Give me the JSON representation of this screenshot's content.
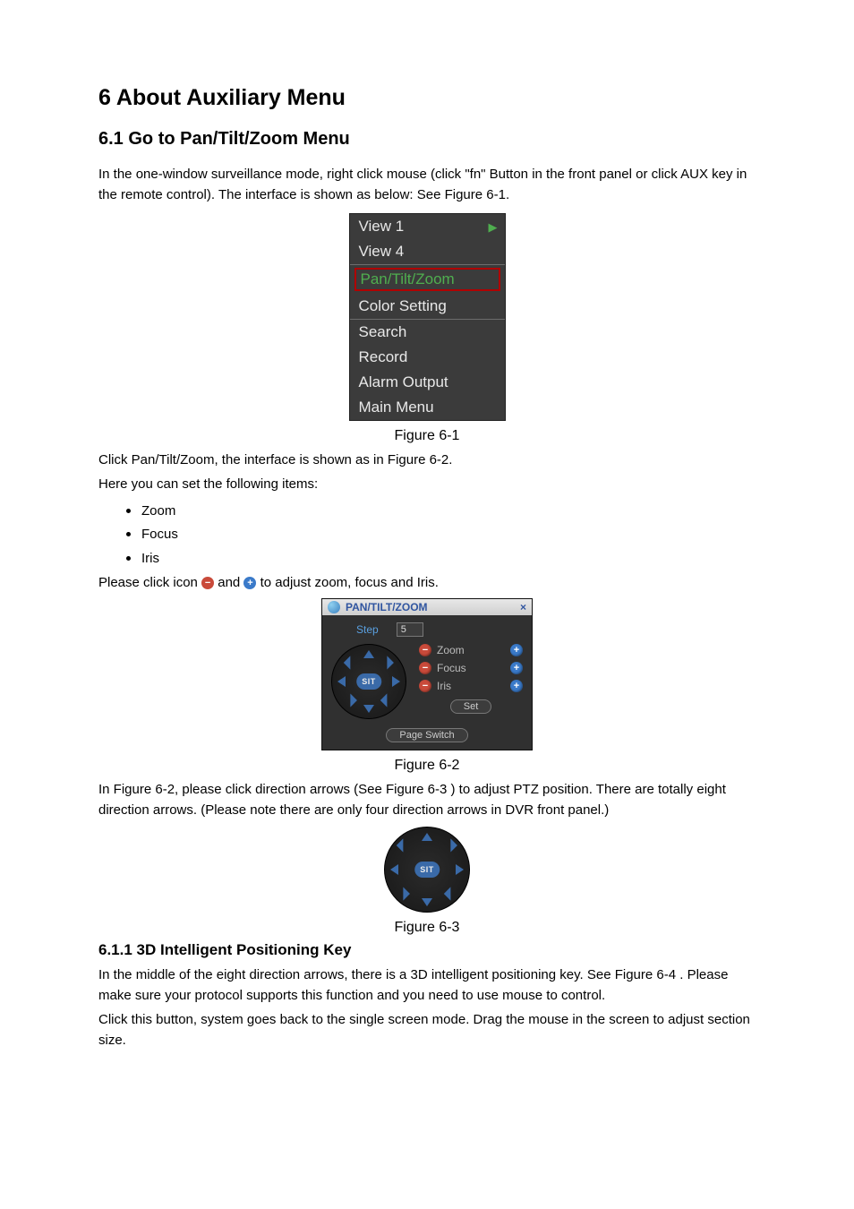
{
  "titles": {
    "h1": "6  About Auxiliary Menu",
    "h2": "6.1    Go to Pan/Tilt/Zoom Menu",
    "h3": "6.1.1  3D Intelligent Positioning Key"
  },
  "paras": {
    "p1": "In the one-window surveillance mode, right click mouse (click \"fn\" Button in the front panel or click AUX key in the remote control). The interface is shown as below: See Figure 6-1.",
    "p2": "Click Pan/Tilt/Zoom, the interface is shown as in Figure 6-2.",
    "p3": "Here you can set the following items:",
    "p4a": "Please click icon ",
    "p4b": " and ",
    "p4c": " to adjust zoom, focus and Iris.",
    "p5": "In Figure 6-2, please click direction arrows (See Figure 6-3 ) to adjust PTZ position. There are totally eight direction arrows. (Please note there are only four direction arrows in DVR front panel.)",
    "p6": "In the middle of the eight direction arrows, there is a 3D intelligent positioning key. See Figure 6-4 . Please make sure your protocol supports this function and you need to use mouse to control.",
    "p7": "Click this button, system goes back to the single screen mode. Drag the mouse in the screen to adjust section size."
  },
  "bullets": {
    "b1": "Zoom",
    "b2": "Focus",
    "b3": "Iris"
  },
  "figcaps": {
    "f1": "Figure 6-1",
    "f2": "Figure 6-2",
    "f3": "Figure 6-3"
  },
  "ctxmenu": {
    "view1": "View 1",
    "view4": "View 4",
    "ptz": "Pan/Tilt/Zoom",
    "color": "Color Setting",
    "search": "Search",
    "record": "Record",
    "alarm": "Alarm Output",
    "main": "Main Menu"
  },
  "ptz": {
    "title": "PAN/TILT/ZOOM",
    "close": "×",
    "step_label": "Step",
    "step_value": "5",
    "zoom": "Zoom",
    "focus": "Focus",
    "iris": "Iris",
    "set": "Set",
    "page_switch": "Page Switch",
    "sit": "SIT"
  },
  "icons": {
    "minus": "−",
    "plus": "+"
  }
}
